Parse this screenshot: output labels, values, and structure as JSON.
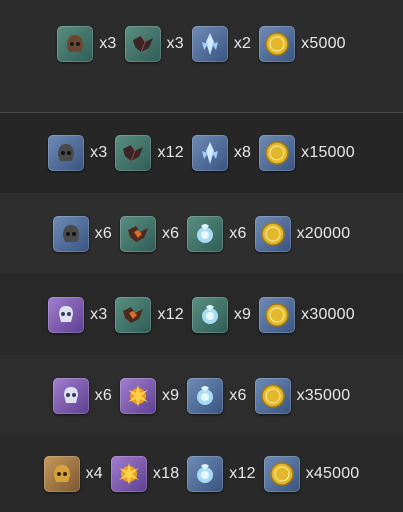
{
  "rows": [
    {
      "items": [
        {
          "icon": "helmet-icon",
          "qty": "x3"
        },
        {
          "icon": "dark-crystal-icon",
          "qty": "x3"
        },
        {
          "icon": "ice-crystal-icon",
          "qty": "x2"
        },
        {
          "icon": "coin-icon",
          "qty": "x5000"
        }
      ]
    },
    {
      "items": [
        {
          "icon": "helmet-icon",
          "qty": "x3"
        },
        {
          "icon": "dark-crystal-icon",
          "qty": "x12"
        },
        {
          "icon": "ice-crystal-icon",
          "qty": "x8"
        },
        {
          "icon": "coin-icon",
          "qty": "x15000"
        }
      ]
    },
    {
      "items": [
        {
          "icon": "helmet-icon",
          "qty": "x6"
        },
        {
          "icon": "fire-crystal-icon",
          "qty": "x6"
        },
        {
          "icon": "ice-orb-icon",
          "qty": "x6"
        },
        {
          "icon": "coin-icon",
          "qty": "x20000"
        }
      ]
    },
    {
      "items": [
        {
          "icon": "skull-mask-icon",
          "qty": "x3"
        },
        {
          "icon": "fire-crystal-icon",
          "qty": "x12"
        },
        {
          "icon": "ice-orb-icon",
          "qty": "x9"
        },
        {
          "icon": "coin-icon",
          "qty": "x30000"
        }
      ]
    },
    {
      "items": [
        {
          "icon": "skull-mask-icon",
          "qty": "x6"
        },
        {
          "icon": "flame-burst-icon",
          "qty": "x9"
        },
        {
          "icon": "ice-orb-icon",
          "qty": "x6"
        },
        {
          "icon": "coin-icon",
          "qty": "x35000"
        }
      ]
    },
    {
      "items": [
        {
          "icon": "golden-helmet-icon",
          "qty": "x4"
        },
        {
          "icon": "flame-burst-icon",
          "qty": "x18"
        },
        {
          "icon": "ice-orb-icon",
          "qty": "x12"
        },
        {
          "icon": "coin-icon",
          "qty": "x45000"
        }
      ]
    }
  ]
}
